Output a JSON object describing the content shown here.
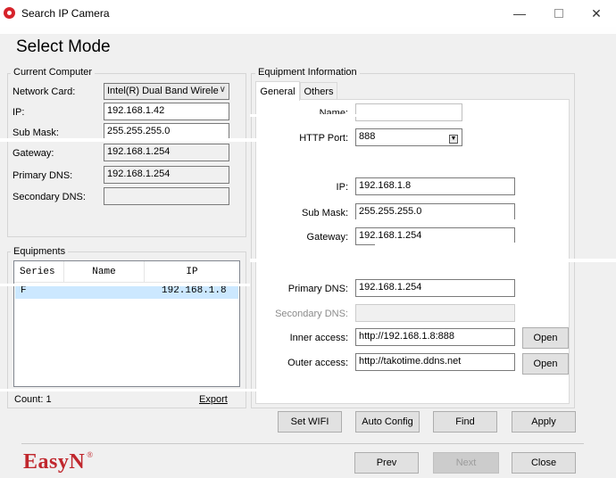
{
  "window": {
    "title": "Search IP Camera",
    "minimize": "—",
    "close": "✕"
  },
  "page_title": "Select Mode",
  "current_computer": {
    "group_label": "Current Computer",
    "network_card_label": "Network Card:",
    "network_card_value": "Intel(R) Dual Band Wirele",
    "ip_label": "IP:",
    "ip_value": "192.168.1.42",
    "submask_label": "Sub Mask:",
    "submask_value": "255.255.255.0",
    "gateway_label": "Gateway:",
    "gateway_value": "192.168.1.254",
    "primary_dns_label": "Primary DNS:",
    "primary_dns_value": "192.168.1.254",
    "secondary_dns_label": "Secondary DNS:",
    "secondary_dns_value": ""
  },
  "equipments": {
    "group_label": "Equipments",
    "columns": [
      "Series",
      "Name",
      "IP"
    ],
    "rows": [
      {
        "series": "F",
        "name": "",
        "ip": "192.168.1.8"
      }
    ],
    "count_label": "Count: 1",
    "export_label": "Export"
  },
  "equipment_info": {
    "group_label": "Equipment Information",
    "tabs": [
      "General",
      "Others"
    ],
    "name_label": "Name:",
    "name_value": "",
    "http_port_label": "HTTP Port:",
    "http_port_value": "888",
    "ip_label": "IP:",
    "ip_value": "192.168.1.8",
    "submask_label": "Sub Mask:",
    "submask_value": "255.255.255.0",
    "gateway_label": "Gateway:",
    "gateway_value": "192.168.1.254",
    "primary_dns_label": "Primary DNS:",
    "primary_dns_value": "192.168.1.254",
    "secondary_dns_label": "Secondary DNS:",
    "secondary_dns_value": "",
    "inner_access_label": "Inner access:",
    "inner_access_value": "http://192.168.1.8:888",
    "outer_access_label": "Outer access:",
    "outer_access_value": "http://takotime.ddns.net",
    "open_label": "Open"
  },
  "actions": {
    "set_wifi": "Set WIFI",
    "auto_config": "Auto Config",
    "find": "Find",
    "apply": "Apply"
  },
  "nav": {
    "prev": "Prev",
    "next": "Next",
    "close": "Close"
  },
  "logo": {
    "text": "EasyN",
    "reg": "®"
  }
}
